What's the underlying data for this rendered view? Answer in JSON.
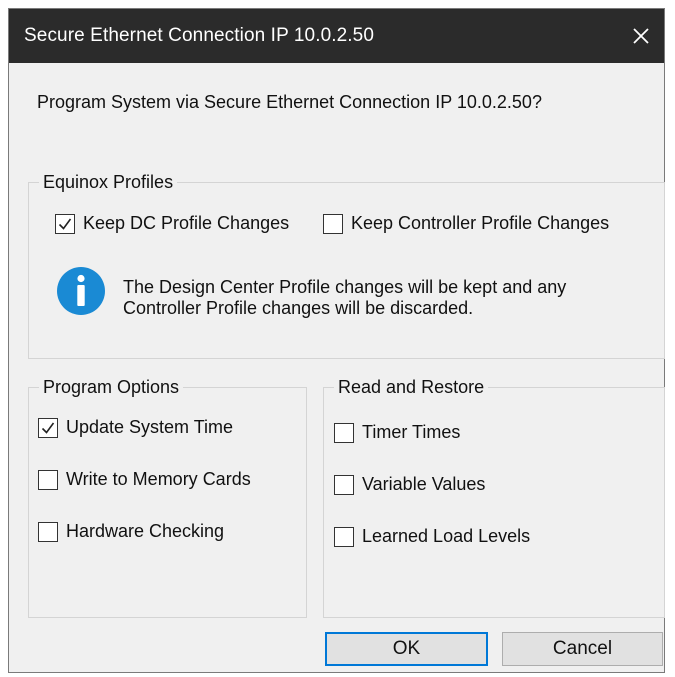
{
  "window": {
    "title": "Secure Ethernet Connection IP 10.0.2.50"
  },
  "prompt": "Program System via Secure Ethernet Connection IP 10.0.2.50?",
  "equinox_profiles": {
    "legend": "Equinox Profiles",
    "options": [
      {
        "label": "Keep DC Profile Changes",
        "checked": true
      },
      {
        "label": "Keep Controller Profile Changes",
        "checked": false
      }
    ],
    "info_text": "The Design Center Profile changes will be kept and any Controller Profile changes will be discarded.",
    "info_icon": "info-icon"
  },
  "program_options": {
    "legend": "Program Options",
    "options": [
      {
        "label": "Update System Time",
        "checked": true
      },
      {
        "label": "Write to Memory Cards",
        "checked": false
      },
      {
        "label": "Hardware Checking",
        "checked": false
      }
    ]
  },
  "read_restore": {
    "legend": "Read and Restore",
    "options": [
      {
        "label": "Timer Times",
        "checked": false
      },
      {
        "label": "Variable Values",
        "checked": false
      },
      {
        "label": "Learned Load Levels",
        "checked": false
      }
    ]
  },
  "buttons": {
    "ok": "OK",
    "cancel": "Cancel"
  },
  "colors": {
    "titlebar": "#2b2b2b",
    "dialog_bg": "#f0f0f0",
    "info_blue": "#1a8ad4",
    "default_button_border": "#0078d7"
  }
}
